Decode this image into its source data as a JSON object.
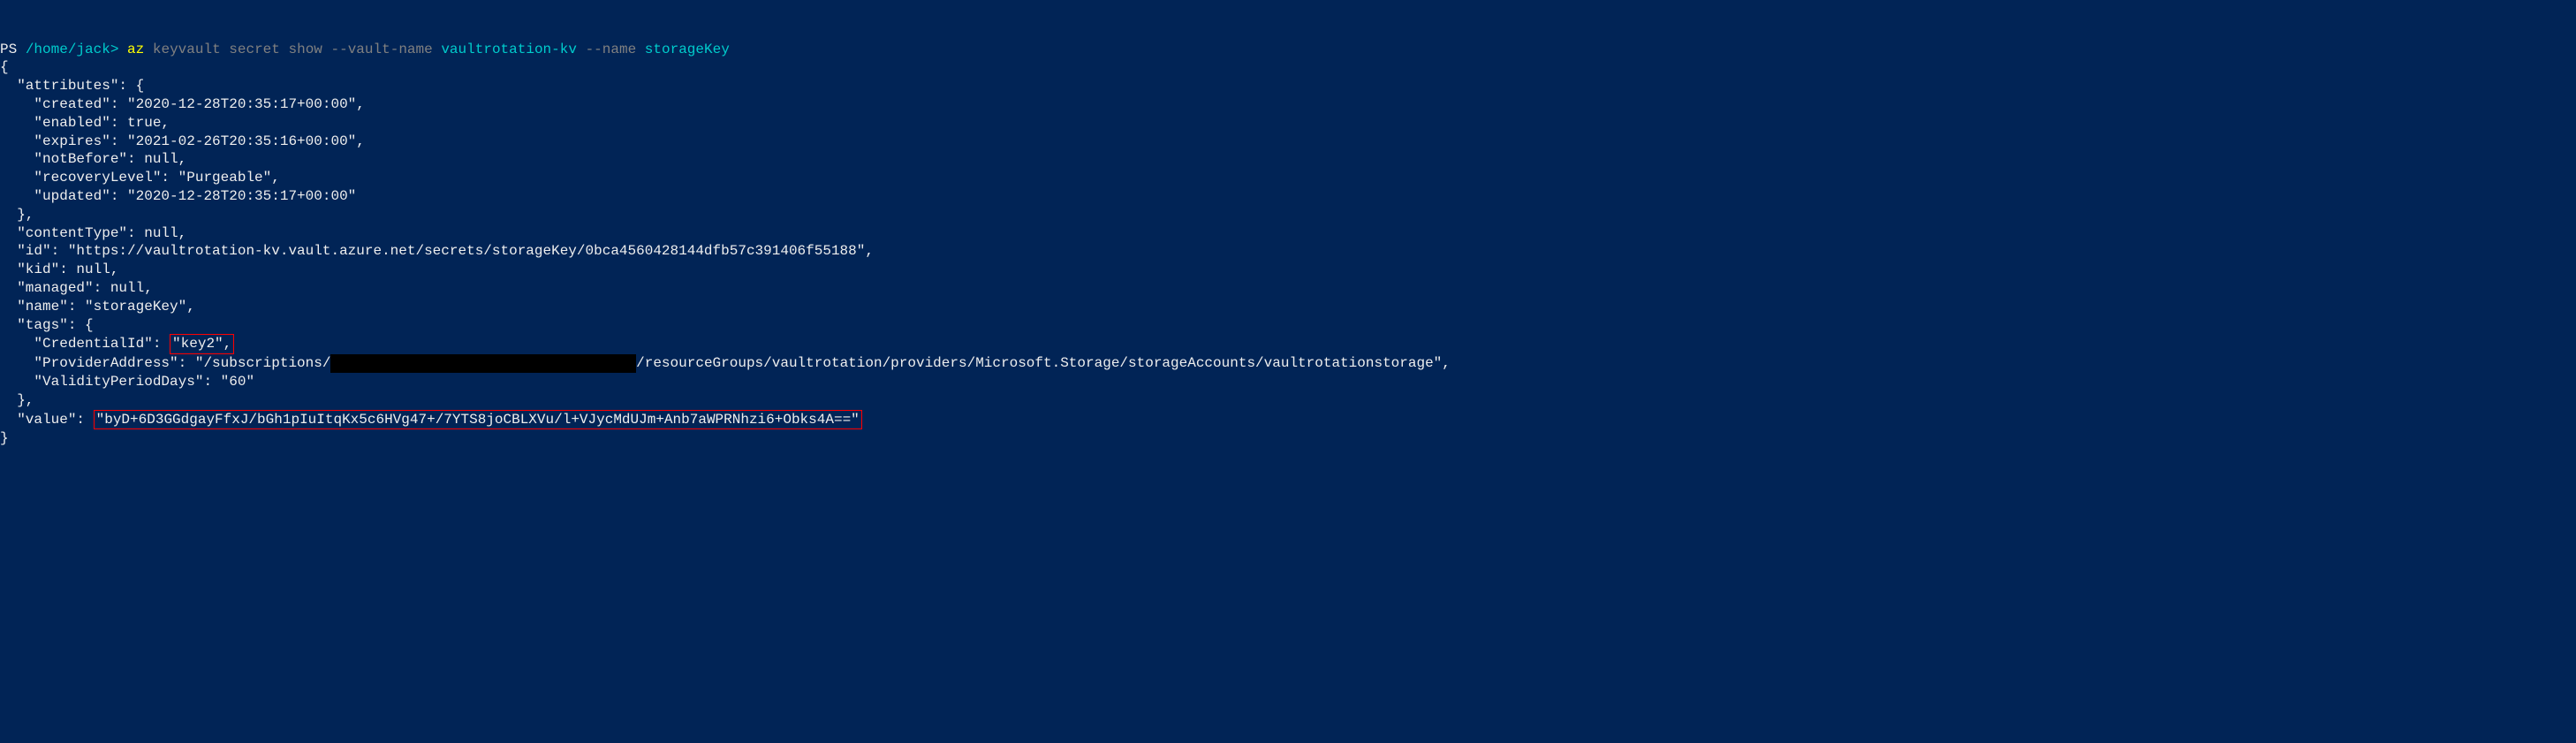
{
  "prompt": {
    "ps": "PS ",
    "path": "/home/jack>",
    "space": " ",
    "cmd": "az ",
    "args_gray": "keyvault secret show ",
    "flag1": "--vault-name ",
    "val1": "vaultrotation-kv ",
    "flag2": "--name ",
    "val2": "storageKey"
  },
  "lines": {
    "l1": "{",
    "l2": "  \"attributes\": {",
    "l3": "    \"created\": \"2020-12-28T20:35:17+00:00\",",
    "l4": "    \"enabled\": true,",
    "l5": "    \"expires\": \"2021-02-26T20:35:16+00:00\",",
    "l6": "    \"notBefore\": null,",
    "l7": "    \"recoveryLevel\": \"Purgeable\",",
    "l8": "    \"updated\": \"2020-12-28T20:35:17+00:00\"",
    "l9": "  },",
    "l10": "  \"contentType\": null,",
    "l11": "  \"id\": \"https://vaultrotation-kv.vault.azure.net/secrets/storageKey/0bca4560428144dfb57c391406f55188\",",
    "l12": "  \"kid\": null,",
    "l13": "  \"managed\": null,",
    "l14": "  \"name\": \"storageKey\",",
    "l15": "  \"tags\": {",
    "l16a": "    \"CredentialId\": ",
    "l16b": "\"key2\",",
    "l17a": "    \"ProviderAddress\": \"/subscriptions/",
    "l17redacted": "xxxxxxxxxxxxxxxxxxxxxxxxxxxxxxxxxxxx",
    "l17b": "/resourceGroups/vaultrotation/providers/Microsoft.Storage/storageAccounts/vaultrotationstorage\",",
    "l18": "    \"ValidityPeriodDays\": \"60\"",
    "l19": "  },",
    "l20a": "  \"value\": ",
    "l20b": "\"byD+6D3GGdgayFfxJ/bGh1pIuItqKx5c6HVg47+/7YTS8joCBLXVu/l+VJycMdUJm+Anb7aWPRNhzi6+Obks4A==\"",
    "l21": "}"
  }
}
